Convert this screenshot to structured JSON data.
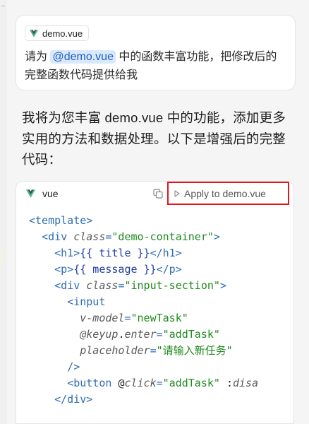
{
  "user_message": {
    "file_chip": "demo.vue",
    "text_before": "请为 ",
    "mention": "@demo.vue",
    "text_after": " 中的函数丰富功能，把修改后的完整函数代码提供给我"
  },
  "assistant": {
    "reply": "我将为您丰富 demo.vue 中的功能，添加更多实用的方法和数据处理。以下是增强后的完整代码："
  },
  "code_block": {
    "language": "vue",
    "apply_label": "Apply to demo.vue",
    "lines": [
      [
        {
          "t": "tag",
          "s": "<template>"
        }
      ],
      [
        {
          "t": "plain",
          "s": "  "
        },
        {
          "t": "tag",
          "s": "<div "
        },
        {
          "t": "attr",
          "s": "class"
        },
        {
          "t": "pun",
          "s": "="
        },
        {
          "t": "str",
          "s": "\"demo-container\""
        },
        {
          "t": "tag",
          "s": ">"
        }
      ],
      [
        {
          "t": "plain",
          "s": "    "
        },
        {
          "t": "tag",
          "s": "<h1>"
        },
        {
          "t": "exp",
          "s": "{{ title }}"
        },
        {
          "t": "tag",
          "s": "</h1>"
        }
      ],
      [
        {
          "t": "plain",
          "s": "    "
        },
        {
          "t": "tag",
          "s": "<p>"
        },
        {
          "t": "exp",
          "s": "{{ message }}"
        },
        {
          "t": "tag",
          "s": "</p>"
        }
      ],
      [
        {
          "t": "plain",
          "s": "    "
        },
        {
          "t": "tag",
          "s": "<div "
        },
        {
          "t": "attr",
          "s": "class"
        },
        {
          "t": "pun",
          "s": "="
        },
        {
          "t": "str",
          "s": "\"input-section\""
        },
        {
          "t": "tag",
          "s": ">"
        }
      ],
      [
        {
          "t": "plain",
          "s": "      "
        },
        {
          "t": "tag",
          "s": "<input"
        }
      ],
      [
        {
          "t": "plain",
          "s": "        "
        },
        {
          "t": "attr",
          "s": "v-model"
        },
        {
          "t": "pun",
          "s": "="
        },
        {
          "t": "str",
          "s": "\"newTask\""
        }
      ],
      [
        {
          "t": "plain",
          "s": "        "
        },
        {
          "t": "attr",
          "s": "@keyup"
        },
        {
          "t": "plain",
          "s": "."
        },
        {
          "t": "attr",
          "s": "enter"
        },
        {
          "t": "pun",
          "s": "="
        },
        {
          "t": "str",
          "s": "\"addTask\""
        }
      ],
      [
        {
          "t": "plain",
          "s": "        "
        },
        {
          "t": "attr",
          "s": "placeholder"
        },
        {
          "t": "pun",
          "s": "="
        },
        {
          "t": "str",
          "s": "\"请输入新任务\""
        }
      ],
      [
        {
          "t": "plain",
          "s": "      "
        },
        {
          "t": "tag",
          "s": "/>"
        }
      ],
      [
        {
          "t": "plain",
          "s": "      "
        },
        {
          "t": "tag",
          "s": "<button "
        },
        {
          "t": "plain",
          "s": "@"
        },
        {
          "t": "attr",
          "s": "click"
        },
        {
          "t": "pun",
          "s": "="
        },
        {
          "t": "str",
          "s": "\"addTask\""
        },
        {
          "t": "plain",
          "s": " :"
        },
        {
          "t": "attr",
          "s": "disa"
        }
      ],
      [
        {
          "t": "plain",
          "s": "    "
        },
        {
          "t": "tag",
          "s": "</div>"
        }
      ]
    ]
  },
  "colors": {
    "apply_highlight": "#e0161b",
    "vue_green": "#41b883",
    "vue_dark": "#34495e",
    "mention_bg": "#d9e8fb"
  }
}
